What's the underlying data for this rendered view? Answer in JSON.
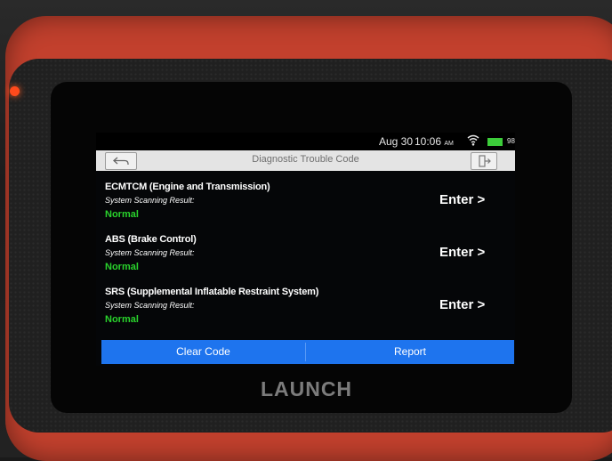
{
  "device": {
    "brand": "LAUNCH"
  },
  "status_bar": {
    "date": "Aug 30",
    "time": "10:06",
    "ampm": "AM",
    "battery": "98%",
    "battery_color": "#3ccc3a"
  },
  "header": {
    "title": "Diagnostic Trouble Code",
    "back_icon": "back-arrow-icon",
    "exit_icon": "exit-icon"
  },
  "systems": [
    {
      "name": "ECMTCM (Engine and Transmission)",
      "caption": "System Scanning Result:",
      "result": "Normal",
      "action": "Enter >"
    },
    {
      "name": "ABS (Brake Control)",
      "caption": "System Scanning Result:",
      "result": "Normal",
      "action": "Enter >"
    },
    {
      "name": "SRS (Supplemental Inflatable Restraint System)",
      "caption": "System Scanning Result:",
      "result": "Normal",
      "action": "Enter >"
    }
  ],
  "footer": {
    "clear_code": "Clear Code",
    "report": "Report"
  },
  "colors": {
    "accent": "#1e74ee",
    "normal": "#29d22c",
    "header_bg": "#e4e4e4"
  }
}
